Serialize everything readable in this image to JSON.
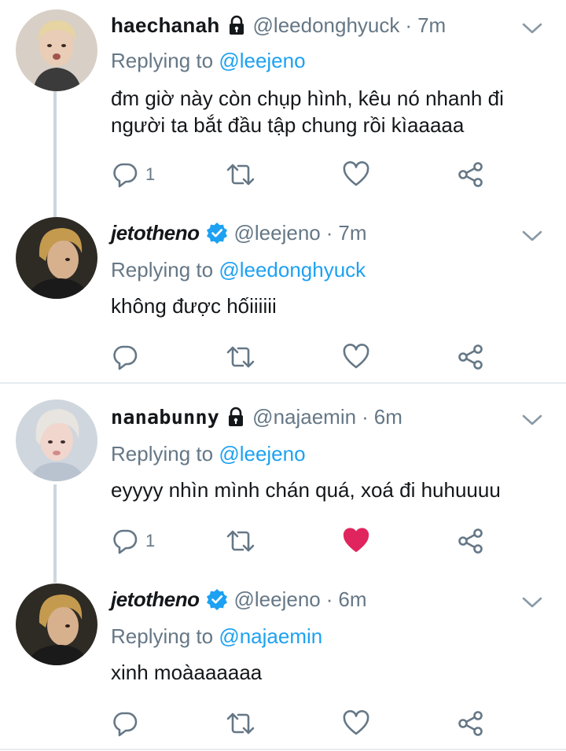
{
  "colors": {
    "accent": "#1da1f2",
    "muted": "#657786",
    "like_active": "#e0245e",
    "verified": "#1da1f2"
  },
  "tweets": [
    {
      "display_name": "haechanah",
      "badge": "lock-icon",
      "handle": "@leedonghyuck",
      "sep": "·",
      "time": "7m",
      "replying_to_label": "Replying to",
      "replying_to": "@leejeno",
      "text_line1": "đm giờ này còn chụp hình, kêu nó nhanh đi",
      "text_line2": "người ta bắt đầu tập chung rồi kìaaaaa",
      "reply_count": "1",
      "liked": false
    },
    {
      "display_name": "jetotheno",
      "badge": "verified-icon",
      "handle": "@leejeno",
      "sep": "·",
      "time": "7m",
      "replying_to_label": "Replying to",
      "replying_to": "@leedonghyuck",
      "text_line1": "không được hốiiiiii",
      "text_line2": "",
      "reply_count": "",
      "liked": false
    },
    {
      "display_name": "nanabunny",
      "badge": "lock-icon",
      "handle": "@najaemin",
      "sep": "·",
      "time": "6m",
      "replying_to_label": "Replying to",
      "replying_to": "@leejeno",
      "text_line1": "eyyyy nhìn mình chán quá, xoá đi huhuuuu",
      "text_line2": "",
      "reply_count": "1",
      "liked": true
    },
    {
      "display_name": "jetotheno",
      "badge": "verified-icon",
      "handle": "@leejeno",
      "sep": "·",
      "time": "6m",
      "replying_to_label": "Replying to",
      "replying_to": "@najaemin",
      "text_line1": "xinh moàaaaaaa",
      "text_line2": "",
      "reply_count": "",
      "liked": false
    }
  ]
}
